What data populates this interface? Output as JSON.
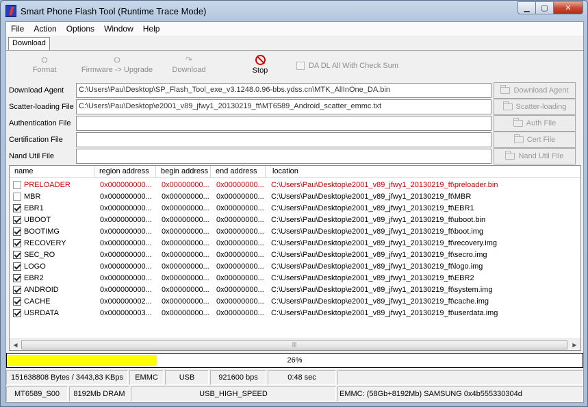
{
  "window": {
    "title": "Smart Phone Flash Tool (Runtime Trace Mode)"
  },
  "menu": [
    "File",
    "Action",
    "Options",
    "Window",
    "Help"
  ],
  "tab": "Download",
  "toolbar": {
    "format": "Format",
    "firmware_upgrade": "Firmware -> Upgrade",
    "download": "Download",
    "stop": "Stop",
    "checksum_option": "DA DL All With Check Sum"
  },
  "fields": [
    {
      "label": "Download Agent",
      "value": "C:\\Users\\Pau\\Desktop\\SP_Flash_Tool_exe_v3.1248.0.96-bbs.ydss.cn\\MTK_AllInOne_DA.bin",
      "button": "Download Agent"
    },
    {
      "label": "Scatter-loading File",
      "value": "C:\\Users\\Pau\\Desktop\\e2001_v89_jfwy1_20130219_ft\\MT6589_Android_scatter_emmc.txt",
      "button": "Scatter-loading"
    },
    {
      "label": "Authentication File",
      "value": "",
      "button": "Auth File"
    },
    {
      "label": "Certification File",
      "value": "",
      "button": "Cert File"
    },
    {
      "label": "Nand Util File",
      "value": "",
      "button": "Nand Util File"
    }
  ],
  "table": {
    "columns": [
      "name",
      "region address",
      "begin address",
      "end address",
      "location"
    ],
    "rows": [
      {
        "checked": false,
        "red": true,
        "name": "PRELOADER",
        "region": "0x000000000...",
        "begin": "0x00000000...",
        "end": "0x00000000...",
        "location": "C:\\Users\\Pau\\Desktop\\e2001_v89_jfwy1_20130219_ft\\preloader.bin"
      },
      {
        "checked": false,
        "red": false,
        "name": "MBR",
        "region": "0x000000000...",
        "begin": "0x00000000...",
        "end": "0x00000000...",
        "location": "C:\\Users\\Pau\\Desktop\\e2001_v89_jfwy1_20130219_ft\\MBR"
      },
      {
        "checked": true,
        "red": false,
        "name": "EBR1",
        "region": "0x000000000...",
        "begin": "0x00000000...",
        "end": "0x00000000...",
        "location": "C:\\Users\\Pau\\Desktop\\e2001_v89_jfwy1_20130219_ft\\EBR1"
      },
      {
        "checked": true,
        "red": false,
        "name": "UBOOT",
        "region": "0x000000000...",
        "begin": "0x00000000...",
        "end": "0x00000000...",
        "location": "C:\\Users\\Pau\\Desktop\\e2001_v89_jfwy1_20130219_ft\\uboot.bin"
      },
      {
        "checked": true,
        "red": false,
        "name": "BOOTIMG",
        "region": "0x000000000...",
        "begin": "0x00000000...",
        "end": "0x00000000...",
        "location": "C:\\Users\\Pau\\Desktop\\e2001_v89_jfwy1_20130219_ft\\boot.img"
      },
      {
        "checked": true,
        "red": false,
        "name": "RECOVERY",
        "region": "0x000000000...",
        "begin": "0x00000000...",
        "end": "0x00000000...",
        "location": "C:\\Users\\Pau\\Desktop\\e2001_v89_jfwy1_20130219_ft\\recovery.img"
      },
      {
        "checked": true,
        "red": false,
        "name": "SEC_RO",
        "region": "0x000000000...",
        "begin": "0x00000000...",
        "end": "0x00000000...",
        "location": "C:\\Users\\Pau\\Desktop\\e2001_v89_jfwy1_20130219_ft\\secro.img"
      },
      {
        "checked": true,
        "red": false,
        "name": "LOGO",
        "region": "0x000000000...",
        "begin": "0x00000000...",
        "end": "0x00000000...",
        "location": "C:\\Users\\Pau\\Desktop\\e2001_v89_jfwy1_20130219_ft\\logo.img"
      },
      {
        "checked": true,
        "red": false,
        "name": "EBR2",
        "region": "0x000000000...",
        "begin": "0x00000000...",
        "end": "0x00000000...",
        "location": "C:\\Users\\Pau\\Desktop\\e2001_v89_jfwy1_20130219_ft\\EBR2"
      },
      {
        "checked": true,
        "red": false,
        "name": "ANDROID",
        "region": "0x000000000...",
        "begin": "0x00000000...",
        "end": "0x00000000...",
        "location": "C:\\Users\\Pau\\Desktop\\e2001_v89_jfwy1_20130219_ft\\system.img"
      },
      {
        "checked": true,
        "red": false,
        "name": "CACHE",
        "region": "0x000000002...",
        "begin": "0x00000000...",
        "end": "0x00000000...",
        "location": "C:\\Users\\Pau\\Desktop\\e2001_v89_jfwy1_20130219_ft\\cache.img"
      },
      {
        "checked": true,
        "red": false,
        "name": "USRDATA",
        "region": "0x000000003...",
        "begin": "0x00000000...",
        "end": "0x00000000...",
        "location": "C:\\Users\\Pau\\Desktop\\e2001_v89_jfwy1_20130219_ft\\userdata.img"
      }
    ]
  },
  "progress": {
    "percent": 26,
    "label": "26%",
    "color": "#ffff00"
  },
  "status": {
    "bytes": "151638808 Bytes / 3443,83 KBps",
    "storage": "EMMC",
    "port": "USB",
    "baud": "921600 bps",
    "time": "0:48 sec",
    "chip": "MT6589_S00",
    "dram": "8192Mb DRAM",
    "speed": "USB_HIGH_SPEED",
    "emmc_info": "EMMC: (58Gb+8192Mb) SAMSUNG 0x4b555330304d"
  },
  "colors": {
    "error_row": "#d40000",
    "stop_icon": "#d50000"
  }
}
